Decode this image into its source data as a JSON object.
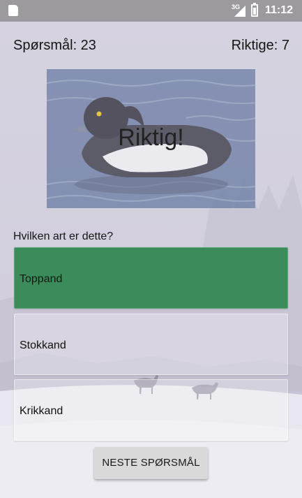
{
  "status_bar": {
    "network": "3G",
    "time": "11:12",
    "icons": [
      "sd-card-icon",
      "signal-icon",
      "battery-icon"
    ]
  },
  "quiz": {
    "question_counter": "Spørsmål: 23",
    "correct_counter": "Riktige: 7",
    "result_text": "Riktig!",
    "question_text": "Hvilken art er dette?",
    "answers": [
      {
        "label": "Toppand",
        "state": "correct"
      },
      {
        "label": "Stokkand",
        "state": "neutral"
      },
      {
        "label": "Krikkand",
        "state": "neutral"
      }
    ],
    "next_button": "NESTE SPØRSMÅL"
  },
  "colors": {
    "correct_answer": "#3b8c5a",
    "status_bar": "#9d9a9f",
    "button": "#dadada"
  }
}
